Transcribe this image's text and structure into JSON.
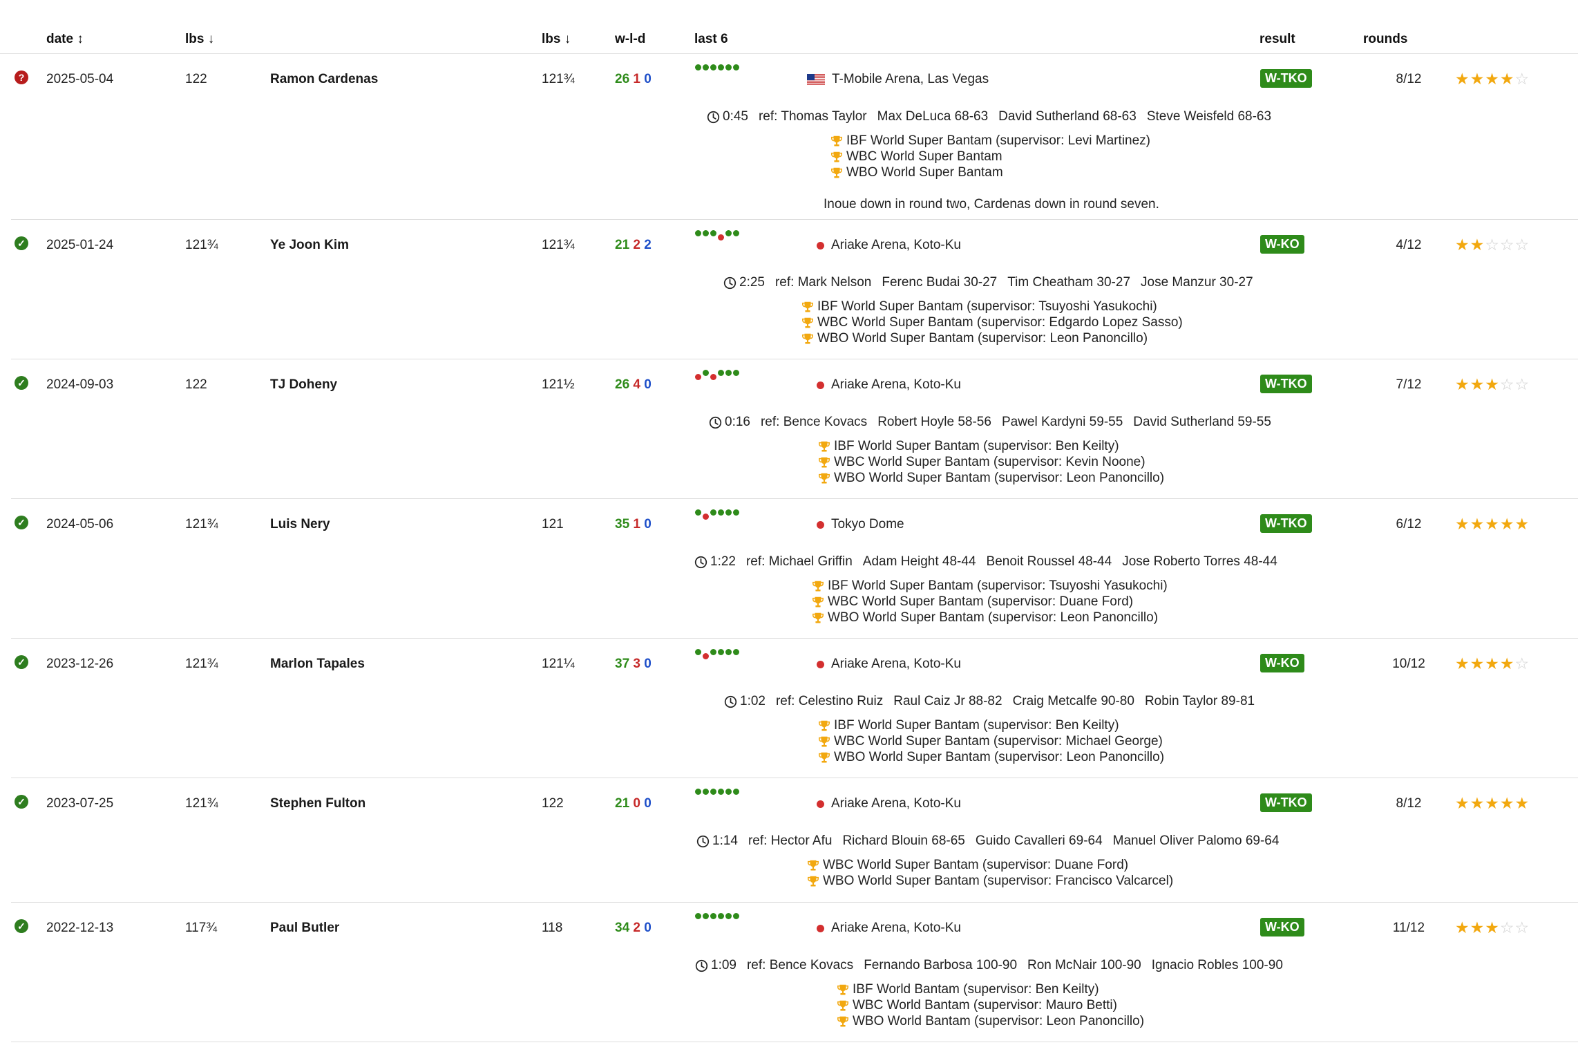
{
  "header": {
    "date": "date ↕",
    "lbs": "lbs ↓",
    "opp_lbs": "lbs ↓",
    "wld": "w-l-d",
    "last6": "last 6",
    "result": "result",
    "rounds": "rounds"
  },
  "bouts": [
    {
      "status": "unknown",
      "status_glyph": "?",
      "date": "2025-05-04",
      "weight": "122",
      "opponent": "Ramon Cardenas",
      "opp_weight": "121¾",
      "record": {
        "w": "26",
        "l": "1",
        "d": "0"
      },
      "last6": [
        "w",
        "w",
        "w",
        "w",
        "w",
        "w"
      ],
      "venue": "T-Mobile Arena, Las Vegas",
      "venue_marker": "flag-us",
      "result": "W-TKO",
      "rounds": "8/12",
      "rating": 4,
      "time": "0:45",
      "officials": [
        "ref: Thomas Taylor",
        "Max DeLuca 68-63",
        "David Sutherland 68-63",
        "Steve Weisfeld 68-63"
      ],
      "titles": [
        "IBF World Super Bantam (supervisor: Levi Martinez)",
        "WBC World Super Bantam",
        "WBO World Super Bantam"
      ],
      "note": "Inoue down in round two, Cardenas down in round seven."
    },
    {
      "status": "win",
      "status_glyph": "✓",
      "date": "2025-01-24",
      "weight": "121¾",
      "opponent": "Ye Joon Kim",
      "opp_weight": "121¾",
      "record": {
        "w": "21",
        "l": "2",
        "d": "2"
      },
      "last6": [
        "w",
        "w",
        "w",
        "l",
        "w",
        "w"
      ],
      "venue": "Ariake Arena, Koto-Ku",
      "venue_marker": "red-dot",
      "result": "W-KO",
      "rounds": "4/12",
      "rating": 2,
      "time": "2:25",
      "officials": [
        "ref: Mark Nelson",
        "Ferenc Budai 30-27",
        "Tim Cheatham 30-27",
        "Jose Manzur 30-27"
      ],
      "titles": [
        "IBF World Super Bantam (supervisor: Tsuyoshi Yasukochi)",
        "WBC World Super Bantam (supervisor: Edgardo Lopez Sasso)",
        "WBO World Super Bantam (supervisor: Leon Panoncillo)"
      ]
    },
    {
      "status": "win",
      "status_glyph": "✓",
      "date": "2024-09-03",
      "weight": "122",
      "opponent": "TJ Doheny",
      "opp_weight": "121½",
      "record": {
        "w": "26",
        "l": "4",
        "d": "0"
      },
      "last6": [
        "l",
        "w",
        "l",
        "w",
        "w",
        "w"
      ],
      "venue": "Ariake Arena, Koto-Ku",
      "venue_marker": "red-dot",
      "result": "W-TKO",
      "rounds": "7/12",
      "rating": 3,
      "time": "0:16",
      "officials": [
        "ref: Bence Kovacs",
        "Robert Hoyle 58-56",
        "Pawel Kardyni 59-55",
        "David Sutherland 59-55"
      ],
      "titles": [
        "IBF World Super Bantam (supervisor: Ben Keilty)",
        "WBC World Super Bantam (supervisor: Kevin Noone)",
        "WBO World Super Bantam (supervisor: Leon Panoncillo)"
      ]
    },
    {
      "status": "win",
      "status_glyph": "✓",
      "date": "2024-05-06",
      "weight": "121¾",
      "opponent": "Luis Nery",
      "opp_weight": "121",
      "record": {
        "w": "35",
        "l": "1",
        "d": "0"
      },
      "last6": [
        "w",
        "l",
        "w",
        "w",
        "w",
        "w"
      ],
      "venue": "Tokyo Dome",
      "venue_marker": "red-dot",
      "result": "W-TKO",
      "rounds": "6/12",
      "rating": 5,
      "time": "1:22",
      "officials": [
        "ref: Michael Griffin",
        "Adam Height 48-44",
        "Benoit Roussel 48-44",
        "Jose Roberto Torres 48-44"
      ],
      "titles": [
        "IBF World Super Bantam (supervisor: Tsuyoshi Yasukochi)",
        "WBC World Super Bantam (supervisor: Duane Ford)",
        "WBO World Super Bantam (supervisor: Leon Panoncillo)"
      ]
    },
    {
      "status": "win",
      "status_glyph": "✓",
      "date": "2023-12-26",
      "weight": "121¾",
      "opponent": "Marlon Tapales",
      "opp_weight": "121¼",
      "record": {
        "w": "37",
        "l": "3",
        "d": "0"
      },
      "last6": [
        "w",
        "l",
        "w",
        "w",
        "w",
        "w"
      ],
      "venue": "Ariake Arena, Koto-Ku",
      "venue_marker": "red-dot",
      "result": "W-KO",
      "rounds": "10/12",
      "rating": 4,
      "time": "1:02",
      "officials": [
        "ref: Celestino Ruiz",
        "Raul Caiz Jr 88-82",
        "Craig Metcalfe 90-80",
        "Robin Taylor 89-81"
      ],
      "titles": [
        "IBF World Super Bantam (supervisor: Ben Keilty)",
        "WBC World Super Bantam (supervisor: Michael George)",
        "WBO World Super Bantam (supervisor: Leon Panoncillo)"
      ]
    },
    {
      "status": "win",
      "status_glyph": "✓",
      "date": "2023-07-25",
      "weight": "121¾",
      "opponent": "Stephen Fulton",
      "opp_weight": "122",
      "record": {
        "w": "21",
        "l": "0",
        "d": "0"
      },
      "last6": [
        "w",
        "w",
        "w",
        "w",
        "w",
        "w"
      ],
      "venue": "Ariake Arena, Koto-Ku",
      "venue_marker": "red-dot",
      "result": "W-TKO",
      "rounds": "8/12",
      "rating": 5,
      "time": "1:14",
      "officials": [
        "ref: Hector Afu",
        "Richard Blouin 68-65",
        "Guido Cavalleri 69-64",
        "Manuel Oliver Palomo 69-64"
      ],
      "titles": [
        "WBC World Super Bantam (supervisor: Duane Ford)",
        "WBO World Super Bantam (supervisor: Francisco Valcarcel)"
      ]
    },
    {
      "status": "win",
      "status_glyph": "✓",
      "date": "2022-12-13",
      "weight": "117¾",
      "opponent": "Paul Butler",
      "opp_weight": "118",
      "record": {
        "w": "34",
        "l": "2",
        "d": "0"
      },
      "last6": [
        "w",
        "w",
        "w",
        "w",
        "w",
        "w"
      ],
      "venue": "Ariake Arena, Koto-Ku",
      "venue_marker": "red-dot",
      "result": "W-KO",
      "rounds": "11/12",
      "rating": 3,
      "time": "1:09",
      "officials": [
        "ref: Bence Kovacs",
        "Fernando Barbosa 100-90",
        "Ron McNair 100-90",
        "Ignacio Robles 100-90"
      ],
      "titles": [
        "IBF World Bantam (supervisor: Ben Keilty)",
        "WBC World Bantam (supervisor: Mauro Betti)",
        "WBO World Bantam (supervisor: Leon Panoncillo)"
      ]
    }
  ],
  "colors": {
    "win": "#2e8b1a",
    "loss": "#d32f2f",
    "draw": "#1e4fc9",
    "star_on": "#f2a80f",
    "star_off": "#cfcfcf",
    "trophy": "#f2a80f"
  },
  "icons": [
    "check-circle-icon",
    "question-circle-icon",
    "clock-icon",
    "trophy-icon",
    "us-flag-icon",
    "star-icon"
  ]
}
